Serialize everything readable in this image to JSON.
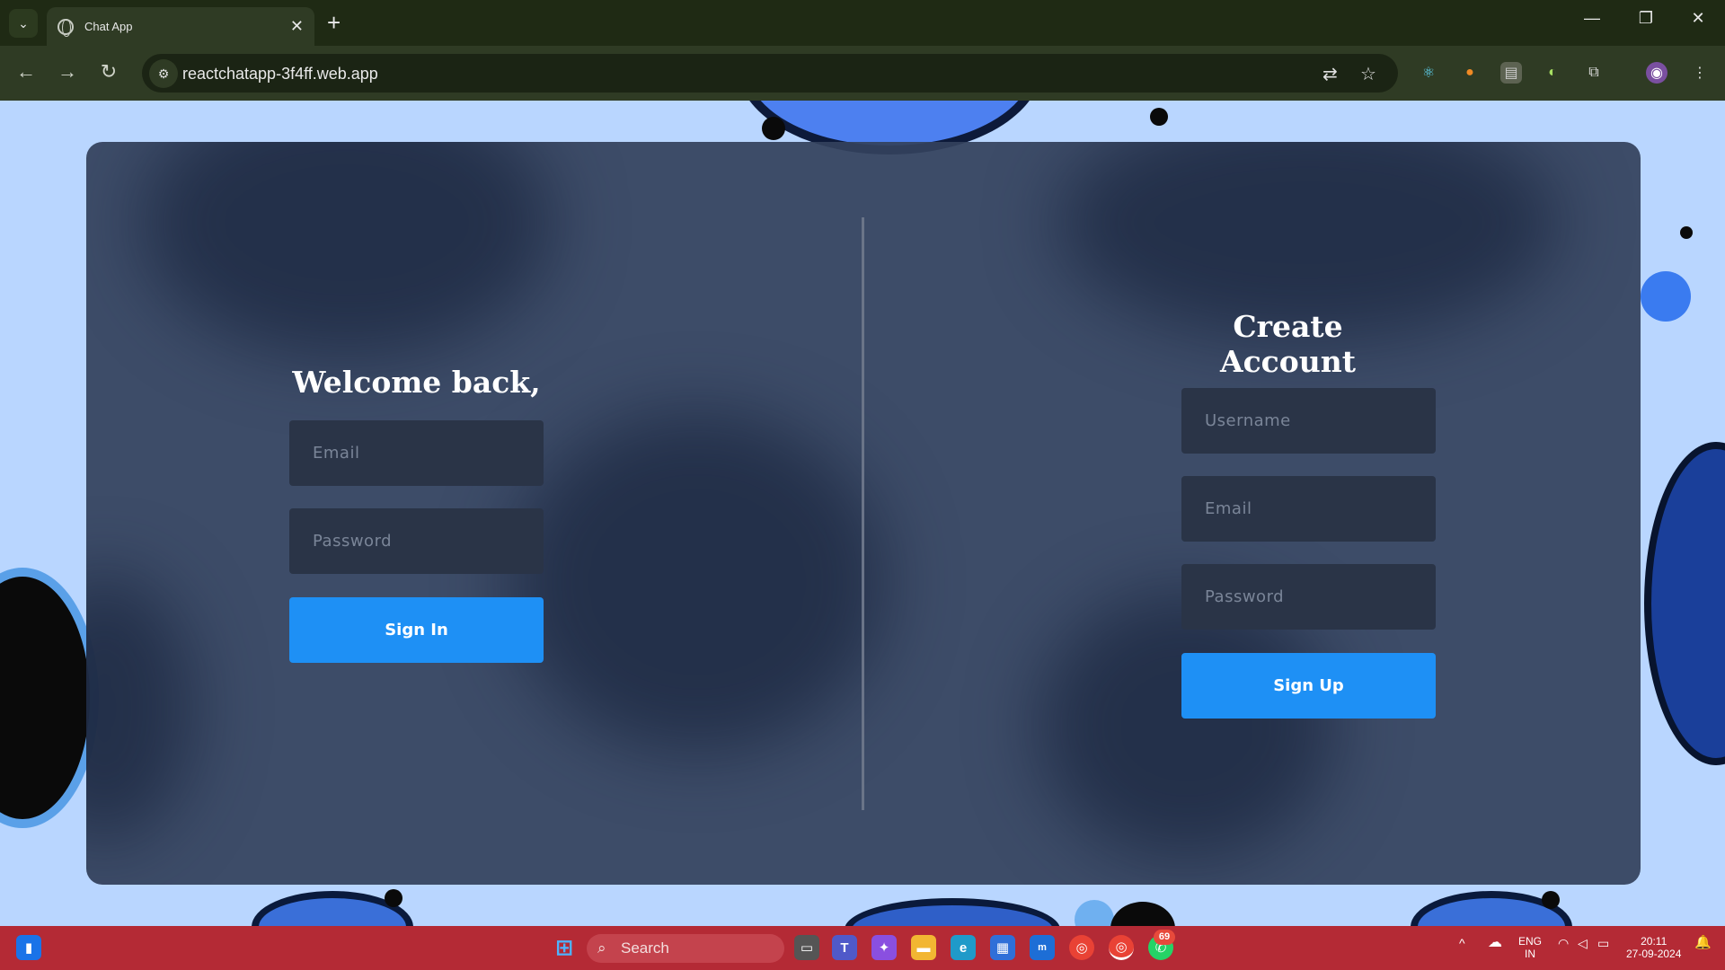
{
  "browser": {
    "tab_title": "Chat App",
    "tab_close": "✕",
    "new_tab": "+",
    "url": "reactchatapp-3f4ff.web.app",
    "window_controls": {
      "minimize": "—",
      "restore": "❐",
      "close": "✕"
    }
  },
  "login": {
    "title": "Welcome back,",
    "email_placeholder": "Email",
    "password_placeholder": "Password",
    "submit_label": "Sign In"
  },
  "signup": {
    "title": "Create Account",
    "username_placeholder": "Username",
    "email_placeholder": "Email",
    "password_placeholder": "Password",
    "submit_label": "Sign Up"
  },
  "taskbar": {
    "search_label": "Search",
    "notification_badge": "69",
    "language_line1": "ENG",
    "language_line2": "IN",
    "time": "20:11",
    "date": "27-09-2024"
  },
  "colors": {
    "accent_button": "#1e90f5",
    "card_background": "#34425c",
    "taskbar": "#b42a35",
    "browser_chrome": "#2f3b24"
  }
}
